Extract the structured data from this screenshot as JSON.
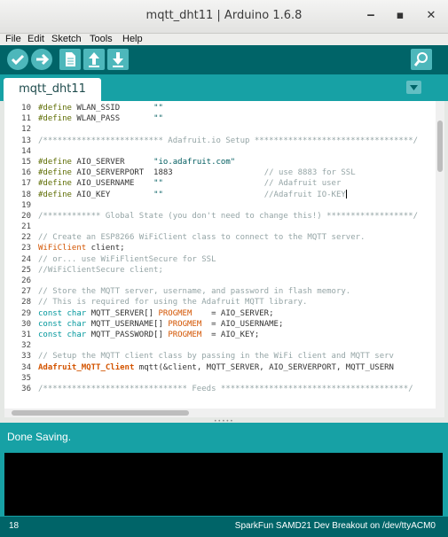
{
  "window": {
    "title": "mqtt_dht11 | Arduino 1.6.8",
    "minimize_glyph": "‒",
    "maximize_glyph": "▪",
    "close_glyph": "✕"
  },
  "menu": [
    "File",
    "Edit",
    "Sketch",
    "Tools",
    "Help"
  ],
  "toolbar": {
    "buttons": [
      {
        "name": "verify",
        "icon": "check-icon"
      },
      {
        "name": "upload",
        "icon": "arrow-right-icon"
      },
      {
        "name": "new",
        "icon": "new-file-icon"
      },
      {
        "name": "open",
        "icon": "arrow-up-icon"
      },
      {
        "name": "save",
        "icon": "arrow-down-icon"
      },
      {
        "name": "serial-monitor",
        "icon": "magnifier-icon"
      }
    ]
  },
  "tabs": {
    "active": "mqtt_dht11",
    "menu_icon": "chevron-down-icon"
  },
  "editor": {
    "lines": [
      {
        "n": "10",
        "code": "#define WLAN_SSID       \"\""
      },
      {
        "n": "11",
        "code": "#define WLAN_PASS       \"\""
      },
      {
        "n": "12",
        "code": ""
      },
      {
        "n": "13",
        "code": "/************************* Adafruit.io Setup *********************************/"
      },
      {
        "n": "14",
        "code": ""
      },
      {
        "n": "15",
        "code": "#define AIO_SERVER      \"io.adafruit.com\""
      },
      {
        "n": "16",
        "code": "#define AIO_SERVERPORT  1883                   // use 8883 for SSL"
      },
      {
        "n": "17",
        "code": "#define AIO_USERNAME    \"\"                     // Adafruit user"
      },
      {
        "n": "18",
        "code": "#define AIO_KEY         \"\"                     //Adafruit IO-KEY"
      },
      {
        "n": "19",
        "code": ""
      },
      {
        "n": "20",
        "code": "/************ Global State (you don't need to change this!) ******************/"
      },
      {
        "n": "21",
        "code": ""
      },
      {
        "n": "22",
        "code": "// Create an ESP8266 WiFiClient class to connect to the MQTT server."
      },
      {
        "n": "23",
        "code": "WiFiClient client;"
      },
      {
        "n": "24",
        "code": "// or... use WiFiFlientSecure for SSL"
      },
      {
        "n": "25",
        "code": "//WiFiClientSecure client;"
      },
      {
        "n": "26",
        "code": ""
      },
      {
        "n": "27",
        "code": "// Store the MQTT server, username, and password in flash memory."
      },
      {
        "n": "28",
        "code": "// This is required for using the Adafruit MQTT library."
      },
      {
        "n": "29",
        "code": "const char MQTT_SERVER[] PROGMEM    = AIO_SERVER;"
      },
      {
        "n": "30",
        "code": "const char MQTT_USERNAME[] PROGMEM  = AIO_USERNAME;"
      },
      {
        "n": "31",
        "code": "const char MQTT_PASSWORD[] PROGMEM  = AIO_KEY;"
      },
      {
        "n": "32",
        "code": ""
      },
      {
        "n": "33",
        "code": "// Setup the MQTT client class by passing in the WiFi client and MQTT serv"
      },
      {
        "n": "34",
        "code": "Adafruit_MQTT_Client mqtt(&client, MQTT_SERVER, AIO_SERVERPORT, MQTT_USERN"
      },
      {
        "n": "35",
        "code": ""
      },
      {
        "n": "36",
        "code": "/****************************** Feeds ***************************************/"
      }
    ]
  },
  "status": {
    "message": "Done Saving."
  },
  "footer": {
    "line_number": "18",
    "board": "SparkFun SAMD21 Dev Breakout on /dev/ttyACM0"
  },
  "colors": {
    "toolbar": "#006468",
    "tabbar": "#17a1a5",
    "button": "#4db7bb",
    "console": "#000000"
  }
}
